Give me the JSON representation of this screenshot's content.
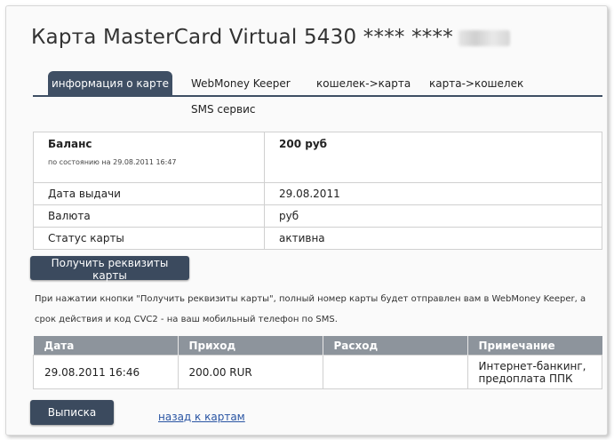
{
  "title": "Карта MasterCard Virtual 5430 **** ****",
  "tabs": [
    {
      "label": "информация о карте"
    },
    {
      "label": "WebMoney Keeper"
    },
    {
      "label": "кошелек->карта"
    },
    {
      "label": "карта->кошелек"
    },
    {
      "label": "SMS сервис"
    }
  ],
  "info": {
    "balance_label": "Баланс",
    "balance_sub": "по состоянию на 29.08.2011 16:47",
    "balance_value": "200 руб",
    "rows": [
      {
        "label": "Дата выдачи",
        "value": "29.08.2011"
      },
      {
        "label": "Валюта",
        "value": "руб"
      },
      {
        "label": "Статус карты",
        "value": "активна"
      }
    ]
  },
  "get_details_button": "Получить реквизиты карты",
  "note": "При нажатии кнопки \"Получить реквизиты карты\", полный номер карты будет отправлен вам в WebMoney Keeper, а срок действия и код CVC2 - на ваш мобильный телефон по SMS.",
  "history": {
    "headers": [
      "Дата",
      "Приход",
      "Расход",
      "Примечание"
    ],
    "rows": [
      {
        "date": "29.08.2011 16:46",
        "income": "200.00 RUR",
        "expense": "",
        "note": "Интернет-банкинг, предоплата ППК"
      }
    ]
  },
  "statement_button": "Выписка",
  "back_link": "назад к картам"
}
